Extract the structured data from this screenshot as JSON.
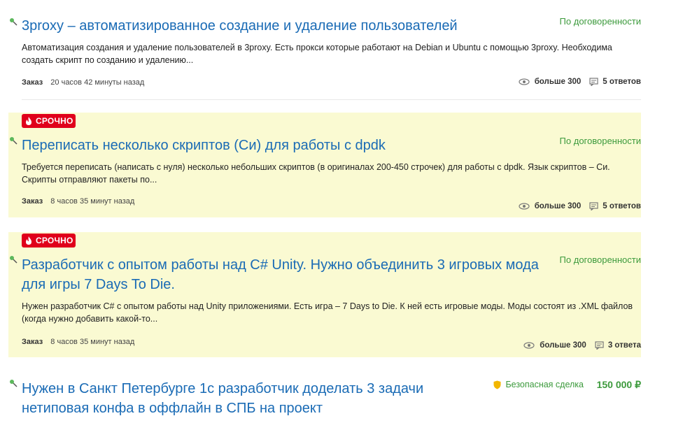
{
  "orders": [
    {
      "title": "3proxy – автоматизированное создание и удаление пользователей",
      "price": "По договоренности",
      "description": "Автоматизация создания и удаление пользователей в 3proxy.  Есть прокси которые работают на Debian и Ubuntu с помощью 3proxy. Необходима создать скрипт по созданию и удалению...",
      "kind": "Заказ",
      "time": "20 часов 42 минуты назад",
      "views": "больше 300",
      "answers": "5 ответов"
    },
    {
      "urgent_label": "СРОЧНО",
      "title": "Переписать несколько скриптов (Си) для работы с dpdk",
      "price": "По договоренности",
      "description": "Требуется переписать (написать с нуля) несколько небольших скриптов (в оригиналах 200-450 строчек) для работы с dpdk. Язык скриптов – Си. Скрипты отправляют пакеты по...",
      "kind": "Заказ",
      "time": "8 часов 35 минут назад",
      "views": "больше 300",
      "answers": "5 ответов"
    },
    {
      "urgent_label": "СРОЧНО",
      "title_line1": "Разработчик с опытом работы над C# Unity. Нужно объединить 3 игровых мода",
      "title_line2": "для игры 7 Days To Die.",
      "price": "По договоренности",
      "description": "Нужен разработчик C# с опытом работы над Unity приложениями. Есть игра – 7 Days to Die. К ней есть игровые моды. Моды состоят из .XML файлов (когда нужно добавить какой-то...",
      "kind": "Заказ",
      "time": "8 часов 35 минут назад",
      "views": "больше 300",
      "answers": "3 ответа"
    },
    {
      "title_line1": "Нужен в Санкт Петербурге 1с разработчик доделать 3 задачи",
      "title_line2": "нетиповая конфа в оффлайн в СПБ на проект",
      "safe_deal": "Безопасная сделка",
      "price": "150 000 ₽"
    }
  ],
  "colors": {
    "link": "#1a6bb5",
    "price": "#3c9a3c",
    "urgent_bg": "#fafad2",
    "badge": "#e0001b"
  },
  "icons": {
    "pin": "pin-icon",
    "fire": "fire-icon",
    "views": "eye-icon",
    "answers": "comment-icon",
    "safe": "shield-icon"
  }
}
